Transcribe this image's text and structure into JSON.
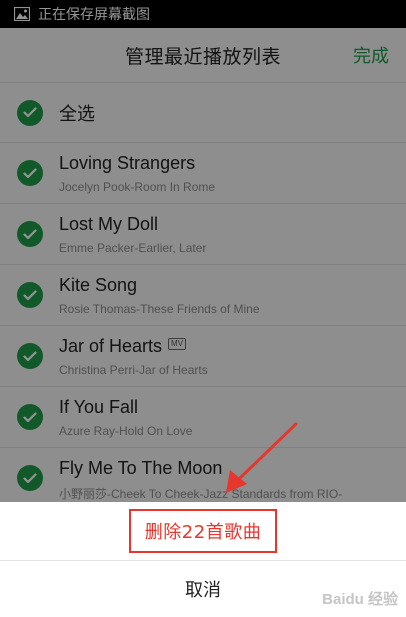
{
  "statusbar": {
    "text": "正在保存屏幕截图",
    "icon": "image-icon"
  },
  "header": {
    "title": "管理最近播放列表",
    "done_label": "完成"
  },
  "select_all": {
    "label": "全选"
  },
  "songs": [
    {
      "title": "Loving Strangers",
      "subtitle": "Jocelyn Pook-Room In Rome",
      "mv": false
    },
    {
      "title": "Lost My Doll",
      "subtitle": "Emme Packer-Earlier, Later",
      "mv": false
    },
    {
      "title": "Kite Song",
      "subtitle": "Rosie Thomas-These Friends of Mine",
      "mv": false
    },
    {
      "title": "Jar of Hearts",
      "subtitle": "Christina Perri-Jar of Hearts",
      "mv": true,
      "badge": "MV"
    },
    {
      "title": "If You Fall",
      "subtitle": "Azure Ray-Hold On Love",
      "mv": false
    },
    {
      "title": "Fly Me To The Moon",
      "subtitle": "小野丽莎-Cheek To Cheek-Jazz Standards from RIO-",
      "mv": false
    }
  ],
  "sheet": {
    "delete_label": "删除22首歌曲",
    "cancel_label": "取消"
  },
  "watermark": "Baidu 经验",
  "colors": {
    "accent": "#1e9a48",
    "delete": "#e5372e",
    "annotation": "#e5372e"
  }
}
